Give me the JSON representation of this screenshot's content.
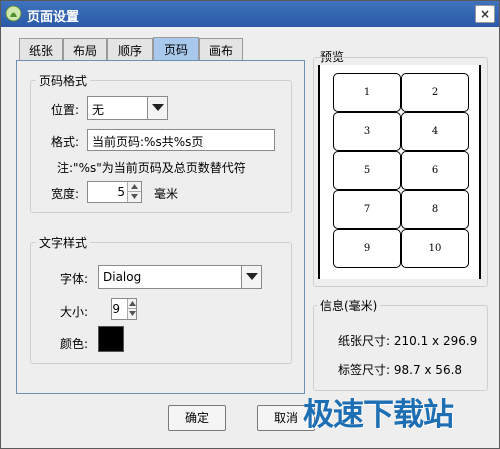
{
  "window": {
    "title": "页面设置",
    "close_glyph": "×"
  },
  "tabs": [
    {
      "label": "纸张",
      "active": false
    },
    {
      "label": "布局",
      "active": false
    },
    {
      "label": "顺序",
      "active": false
    },
    {
      "label": "页码",
      "active": true
    },
    {
      "label": "画布",
      "active": false
    }
  ],
  "page_number_format": {
    "group_title": "页码格式",
    "position_label": "位置:",
    "position_value": "无",
    "format_label": "格式:",
    "format_value": "当前页码:%s共%s页",
    "note": "注:\"%s\"为当前页码及总页数替代符",
    "width_label": "宽度:",
    "width_value": "5",
    "width_unit": "毫米"
  },
  "text_style": {
    "group_title": "文字样式",
    "font_label": "字体:",
    "font_value": "Dialog",
    "size_label": "大小:",
    "size_value": "9",
    "color_label": "颜色:",
    "color_value": "#000000"
  },
  "preview": {
    "title": "预览",
    "cells": [
      "1",
      "2",
      "3",
      "4",
      "5",
      "6",
      "7",
      "8",
      "9",
      "10"
    ]
  },
  "info": {
    "title": "信息(毫米)",
    "paper_size": "纸张尺寸: 210.1 x 296.9",
    "label_size": "标签尺寸: 98.7 x 56.8"
  },
  "buttons": {
    "ok": "确定",
    "cancel": "取消"
  },
  "watermark": "极速下载站",
  "colors": {
    "titlebar": "#2f62ad",
    "active_tab": "#a8c8ec",
    "watermark": "#1e6eb4"
  }
}
